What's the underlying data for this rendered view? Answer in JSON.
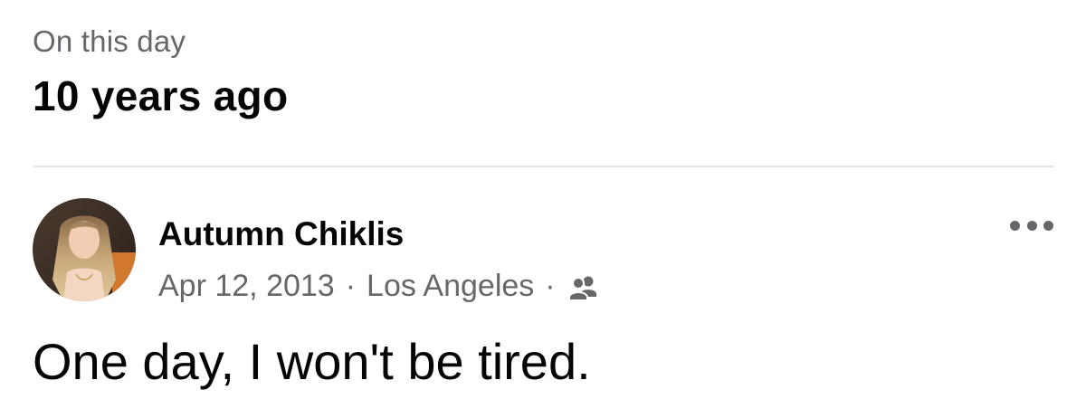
{
  "memory": {
    "eyebrow": "On this day",
    "headline": "10 years ago"
  },
  "post": {
    "author": "Autumn Chiklis",
    "date": "Apr 12, 2013",
    "separator": "·",
    "location": "Los Angeles",
    "audience_icon": "friends-audience-icon",
    "more_icon": "more-options-icon",
    "text": "One day, I won't be tired."
  },
  "colors": {
    "primary_text": "#050505",
    "secondary_text": "#65676b",
    "divider": "#e4e6eb"
  }
}
